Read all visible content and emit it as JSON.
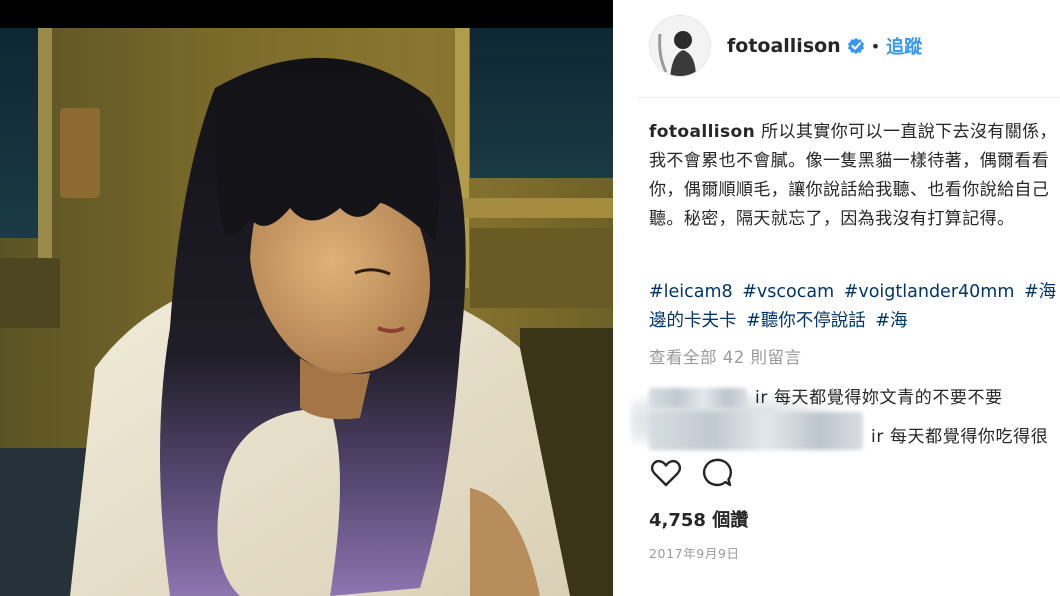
{
  "post": {
    "image_alt": "Portrait photo",
    "username": "fotoallison",
    "follow_label": "追蹤",
    "separator": "•",
    "caption": "所以其實你可以一直說下去沒有關係，我不會累也不會膩。像一隻黑貓一樣待著，偶爾看看你，偶爾順順毛，讓你說話給我聽、也看你說給自己聽。秘密，隔天就忘了，因為我沒有打算記得。",
    "hashtags": [
      "#leicam8",
      "#vscocam",
      "#voigtlander40mm",
      "#海邊的卡夫卡",
      "#聽你不停說話",
      "#海"
    ],
    "view_all_comments": "查看全部 42 則留言",
    "comments": [
      {
        "username": "ir",
        "text": "每天都覺得妳文青的不要不要"
      },
      {
        "username": "ir",
        "text": "每天都覺得你吃得很"
      }
    ],
    "likes": "4,758 個讚",
    "date": "2017年9月9日"
  },
  "colors": {
    "link_blue": "#3897f0",
    "hashtag": "#003569",
    "meta_gray": "#999999",
    "text": "#262626"
  },
  "icons": {
    "verified": "verified-badge-icon",
    "like": "heart-icon",
    "comment": "comment-bubble-icon"
  }
}
